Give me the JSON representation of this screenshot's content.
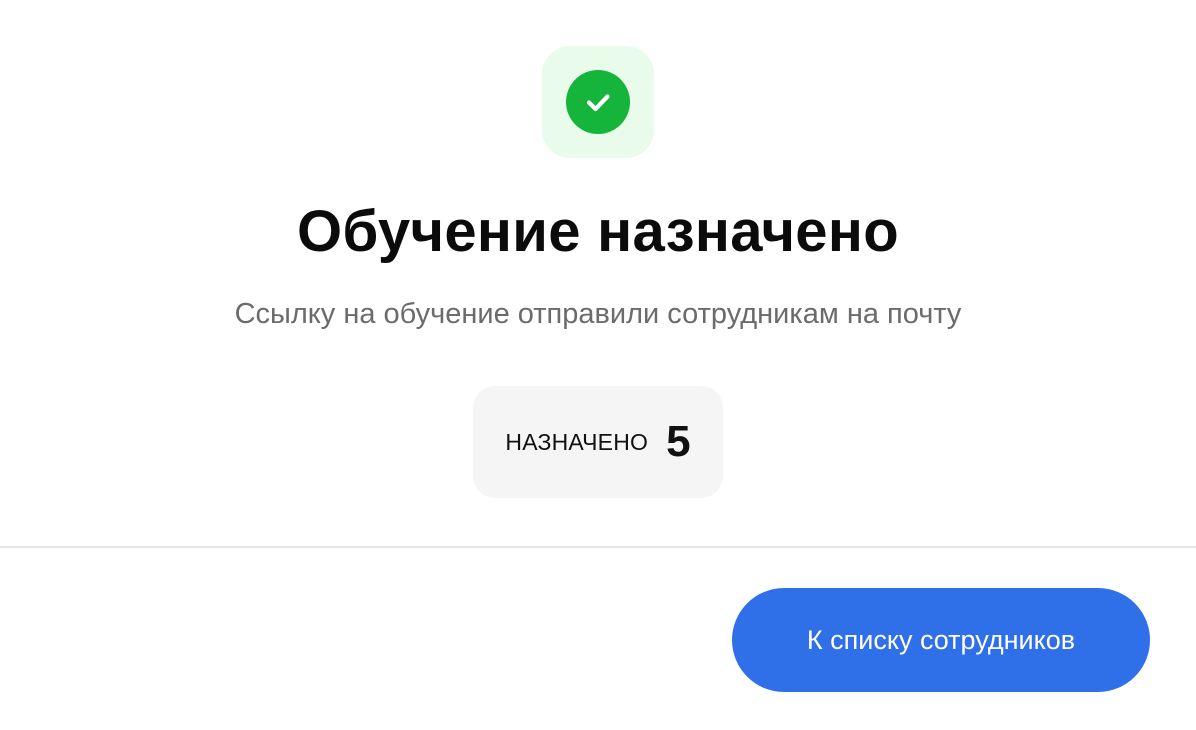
{
  "dialog": {
    "title": "Обучение назначено",
    "subtitle": "Ссылку на обучение отправили сотрудникам на почту",
    "status_icon": "check-circle-icon",
    "status_color": "#14b53a",
    "counter": {
      "label": "НАЗНАЧЕНО",
      "value": "5"
    },
    "footer": {
      "primary_button_label": "К списку сотрудников",
      "primary_button_color": "#2f6fe8"
    }
  }
}
